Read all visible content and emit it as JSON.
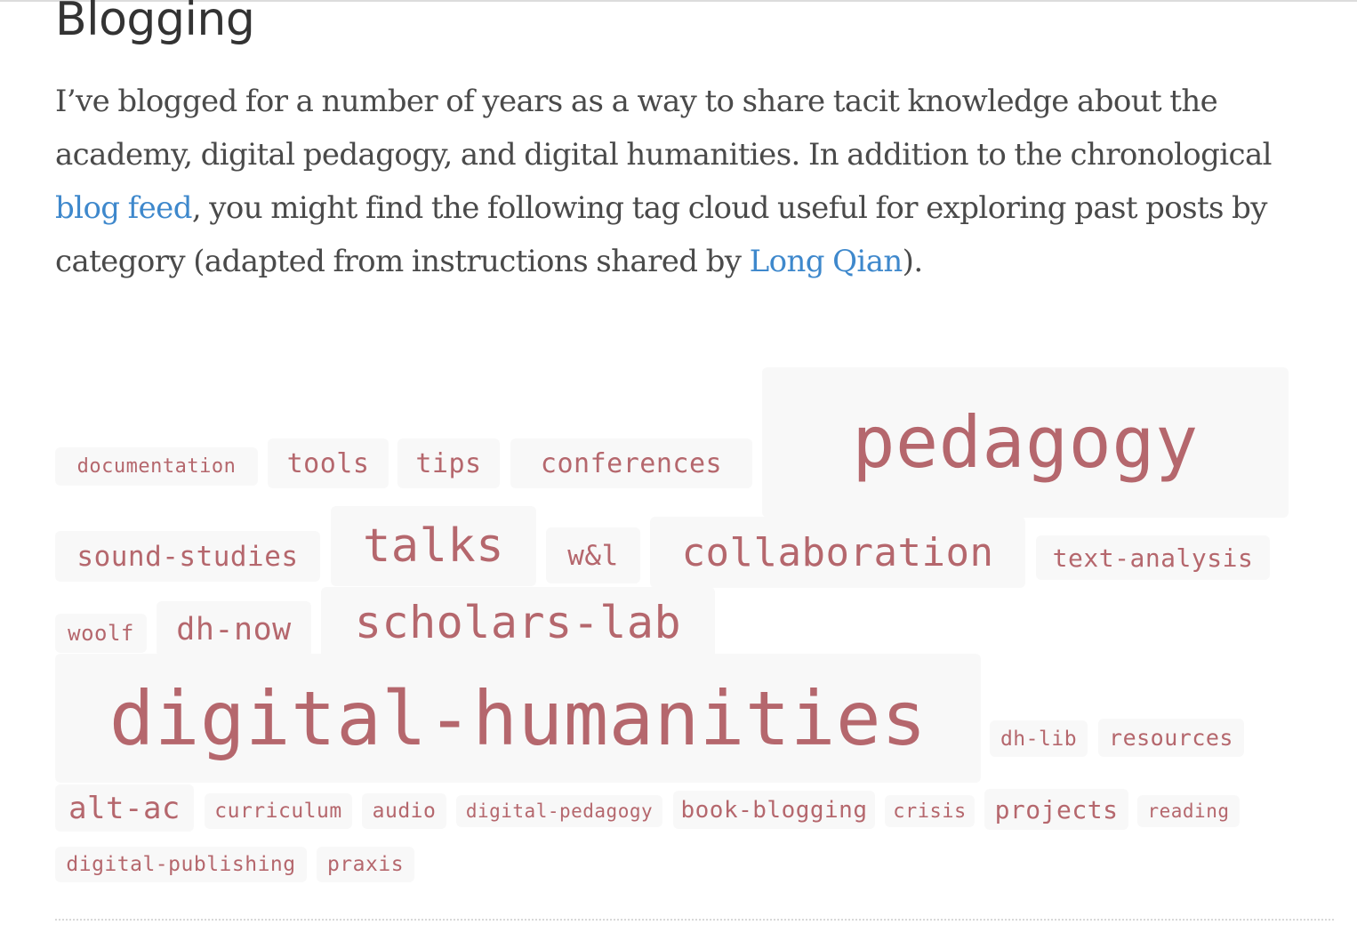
{
  "header": {
    "title": "Blogging"
  },
  "intro": {
    "part1": "I’ve blogged for a number of years as a way to share tacit knowledge about the academy, digital pedagogy, and digital humanities. In addition to the chronological ",
    "link1": "blog feed",
    "part2": ", you might find the following tag cloud useful for exploring past posts by category (adapted from instructions shared by ",
    "link2": "Long Qian",
    "part3": ")."
  },
  "colors": {
    "tag_text": "#b5676d",
    "tag_bg": "#f8f8f8",
    "link": "#3e88cc",
    "body_text": "#4a4a4a"
  },
  "tag_cloud": {
    "tags": [
      "documentation",
      "tools",
      "tips",
      "conferences",
      "pedagogy",
      "sound-studies",
      "talks",
      "w&l",
      "collaboration",
      "text-analysis",
      "woolf",
      "dh-now",
      "scholars-lab",
      "digital-humanities",
      "dh-lib",
      "resources",
      "alt-ac",
      "curriculum",
      "audio",
      "digital-pedagogy",
      "book-blogging",
      "crisis",
      "projects",
      "reading",
      "digital-publishing",
      "praxis"
    ]
  }
}
